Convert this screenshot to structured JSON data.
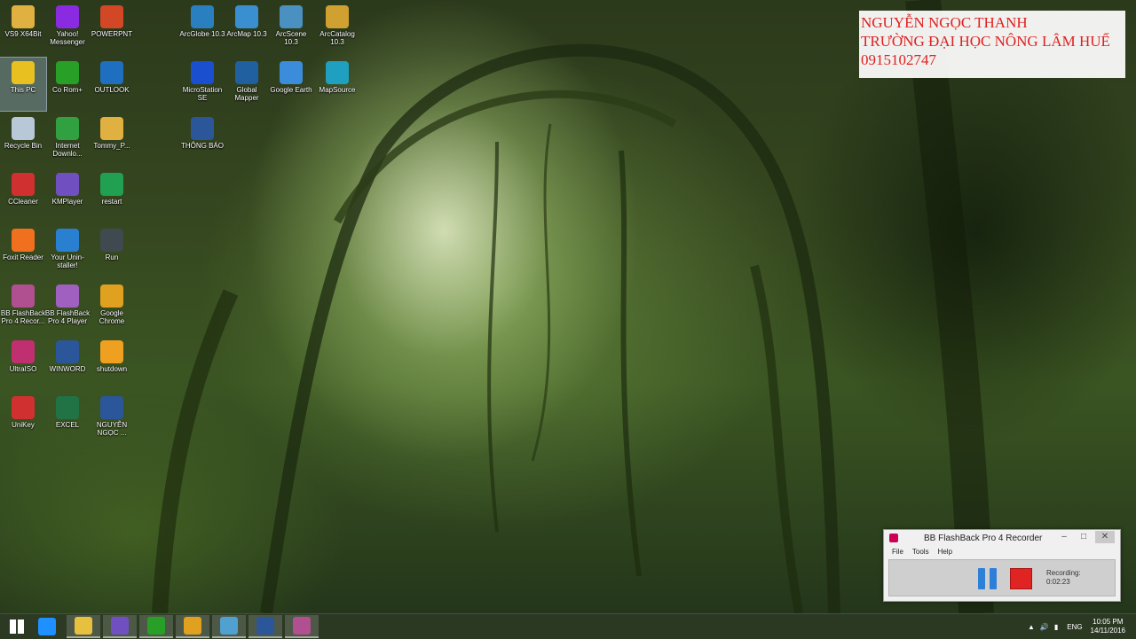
{
  "desktop": {
    "icons": [
      {
        "label": "VS9 X64Bit",
        "icon": "folder-icon",
        "color": "#e0b040"
      },
      {
        "label": "Yahoo! Messenger",
        "icon": "yahoo-icon",
        "color": "#8a2be2"
      },
      {
        "label": "POWERPNT",
        "icon": "powerpoint-icon",
        "color": "#d24726"
      },
      {
        "label": "ArcGlobe 10.3",
        "icon": "arcglobe-icon",
        "color": "#2a7fc0"
      },
      {
        "label": "ArcMap 10.3",
        "icon": "arcmap-icon",
        "color": "#3a8fd0"
      },
      {
        "label": "ArcScene 10.3",
        "icon": "arcscene-icon",
        "color": "#4a90c0"
      },
      {
        "label": "ArcCatalog 10.3",
        "icon": "arccatalog-icon",
        "color": "#d0a030"
      },
      {
        "label": "This PC",
        "icon": "this-pc-icon",
        "color": "#e8c020"
      },
      {
        "label": "Co Rom+",
        "icon": "coccoc-icon",
        "color": "#28a028"
      },
      {
        "label": "OUTLOOK",
        "icon": "outlook-icon",
        "color": "#1e6fc0"
      },
      {
        "label": "MicroStation SE",
        "icon": "microstation-icon",
        "color": "#1a4fd0"
      },
      {
        "label": "Global Mapper",
        "icon": "global-mapper-icon",
        "color": "#2060a0"
      },
      {
        "label": "Google Earth",
        "icon": "google-earth-icon",
        "color": "#3c8cdc"
      },
      {
        "label": "MapSource",
        "icon": "mapsource-icon",
        "color": "#20a0c0"
      },
      {
        "label": "Recycle Bin",
        "icon": "recycle-bin-icon",
        "color": "#b8c8d8"
      },
      {
        "label": "Internet Downlo...",
        "icon": "idm-icon",
        "color": "#30a040"
      },
      {
        "label": "Tommy_P...",
        "icon": "folder-icon",
        "color": "#e0b040"
      },
      {
        "label": "THÔNG BÁO",
        "icon": "word-doc-icon",
        "color": "#2b579a"
      },
      {
        "label": "CCleaner",
        "icon": "ccleaner-icon",
        "color": "#d03030"
      },
      {
        "label": "KMPlayer",
        "icon": "kmplayer-icon",
        "color": "#7050c0"
      },
      {
        "label": "restart",
        "icon": "restart-icon",
        "color": "#20a050"
      },
      {
        "label": "Foxit Reader",
        "icon": "foxit-icon",
        "color": "#f07020"
      },
      {
        "label": "Your Unin-staller!",
        "icon": "uninstaller-icon",
        "color": "#2a80d0"
      },
      {
        "label": "Run",
        "icon": "run-icon",
        "color": "#404850"
      },
      {
        "label": "BB FlashBack Pro 4 Recor...",
        "icon": "bb-recorder-icon",
        "color": "#b05090"
      },
      {
        "label": "BB FlashBack Pro 4 Player",
        "icon": "bb-player-icon",
        "color": "#a060c0"
      },
      {
        "label": "Google Chrome",
        "icon": "chrome-icon",
        "color": "#e0a020"
      },
      {
        "label": "UltraISO",
        "icon": "ultraiso-icon",
        "color": "#c03070"
      },
      {
        "label": "WINWORD",
        "icon": "word-icon",
        "color": "#2b579a"
      },
      {
        "label": "shutdown",
        "icon": "shutdown-icon",
        "color": "#f0a020"
      },
      {
        "label": "UniKey",
        "icon": "unikey-icon",
        "color": "#d03030"
      },
      {
        "label": "EXCEL",
        "icon": "excel-icon",
        "color": "#217346"
      },
      {
        "label": "NGUYỄN NGỌC ...",
        "icon": "word-doc-icon",
        "color": "#2b579a"
      }
    ]
  },
  "note": {
    "line1": "NGUYỄN NGỌC THANH",
    "line2": "TRƯỜNG ĐẠI HỌC NÔNG LÂM HUẾ",
    "line3": "0915102747"
  },
  "recorder": {
    "title": "BB FlashBack Pro 4 Recorder",
    "menu": [
      "File",
      "Tools",
      "Help"
    ],
    "status_label": "Recording:",
    "status_time": "0:02:23"
  },
  "taskbar": {
    "apps": [
      "windows-start-icon",
      "internet-explorer-icon",
      "file-explorer-icon",
      "kmplayer-icon",
      "coccoc-icon",
      "chrome-icon",
      "paint-icon",
      "word-icon",
      "bb-recorder-icon"
    ],
    "language": "ENG",
    "time": "10:05 PM",
    "date": "14/11/2016"
  }
}
